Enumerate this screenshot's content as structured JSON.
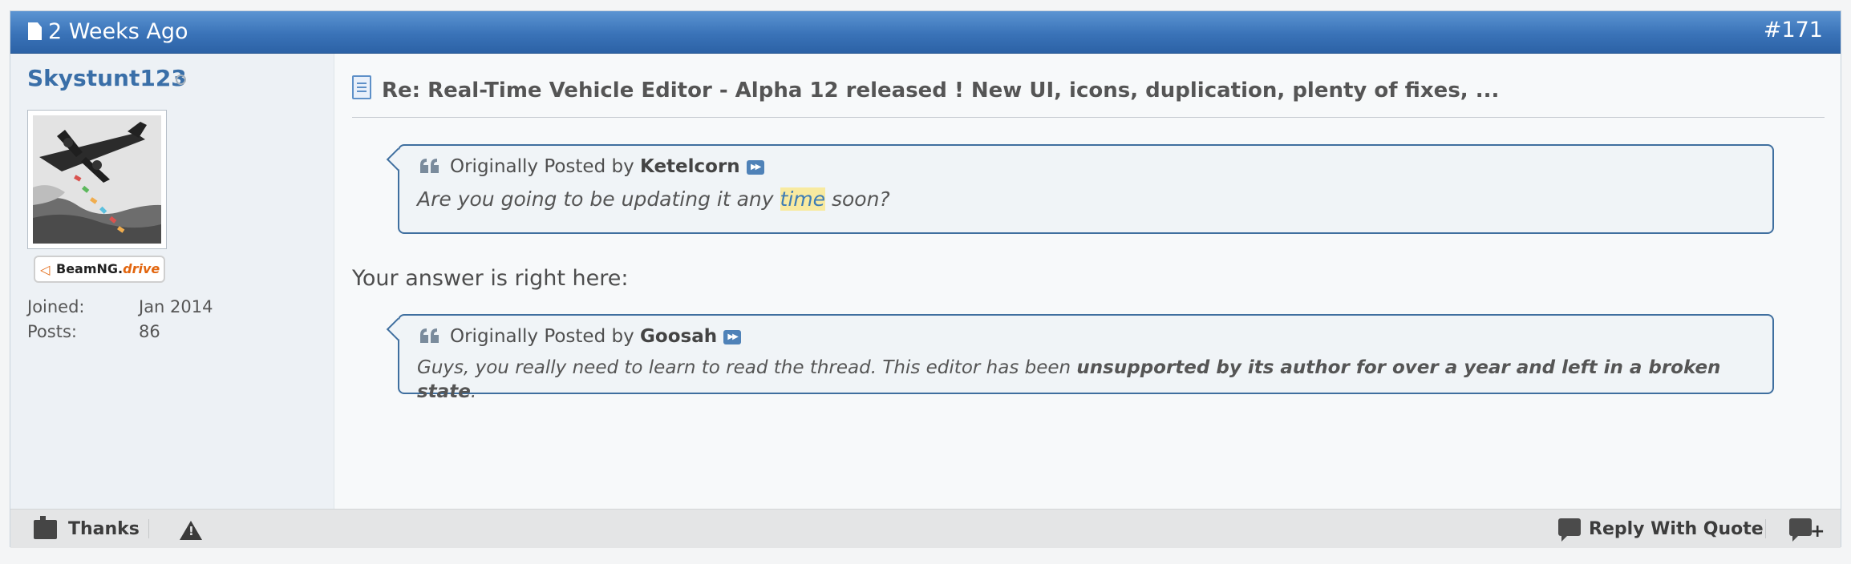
{
  "post": {
    "date": "2 Weeks Ago",
    "number": "#171",
    "title": "Re: Real-Time Vehicle Editor - Alpha 12 released ! New UI, icons, duplication, plenty of fixes, ..."
  },
  "user": {
    "name": "Skystunt123",
    "rank_badge": {
      "brand": "BeamNG.",
      "brand_accent": "drive"
    },
    "info": [
      {
        "key": "Joined:",
        "value": "Jan 2014"
      },
      {
        "key": "Posts:",
        "value": "86"
      }
    ]
  },
  "quotes": [
    {
      "prefix": "Originally Posted by",
      "author": "Ketelcorn",
      "text_before": "Are you going to be updating it any ",
      "highlight": "time",
      "text_after": " soon?"
    },
    {
      "prefix": "Originally Posted by",
      "author": "Goosah",
      "text_before": "Guys, you really need to learn to read the thread. This editor has been ",
      "bold": "unsupported by its author for over a year and left in a broken state",
      "text_after": "."
    }
  ],
  "answer_text": "Your answer is right here:",
  "footer": {
    "thanks_label": "Thanks",
    "reply_with_quote_label": "Reply With Quote"
  },
  "icons": {
    "header": "page-icon",
    "title": "document-icon",
    "quote": "quote-marks-icon",
    "view_post": "view-post-arrow-icon",
    "thanks": "thanks-icon",
    "report": "warning-icon",
    "reply_with_quote": "reply-quote-icon",
    "multi_quote": "multi-quote-icon"
  },
  "colors": {
    "header": "#3a73b8",
    "username": "#3a6fa8",
    "quote_border": "#3f6f9f",
    "highlight": "#f8eaa0",
    "rank_accent": "#e2660f"
  }
}
